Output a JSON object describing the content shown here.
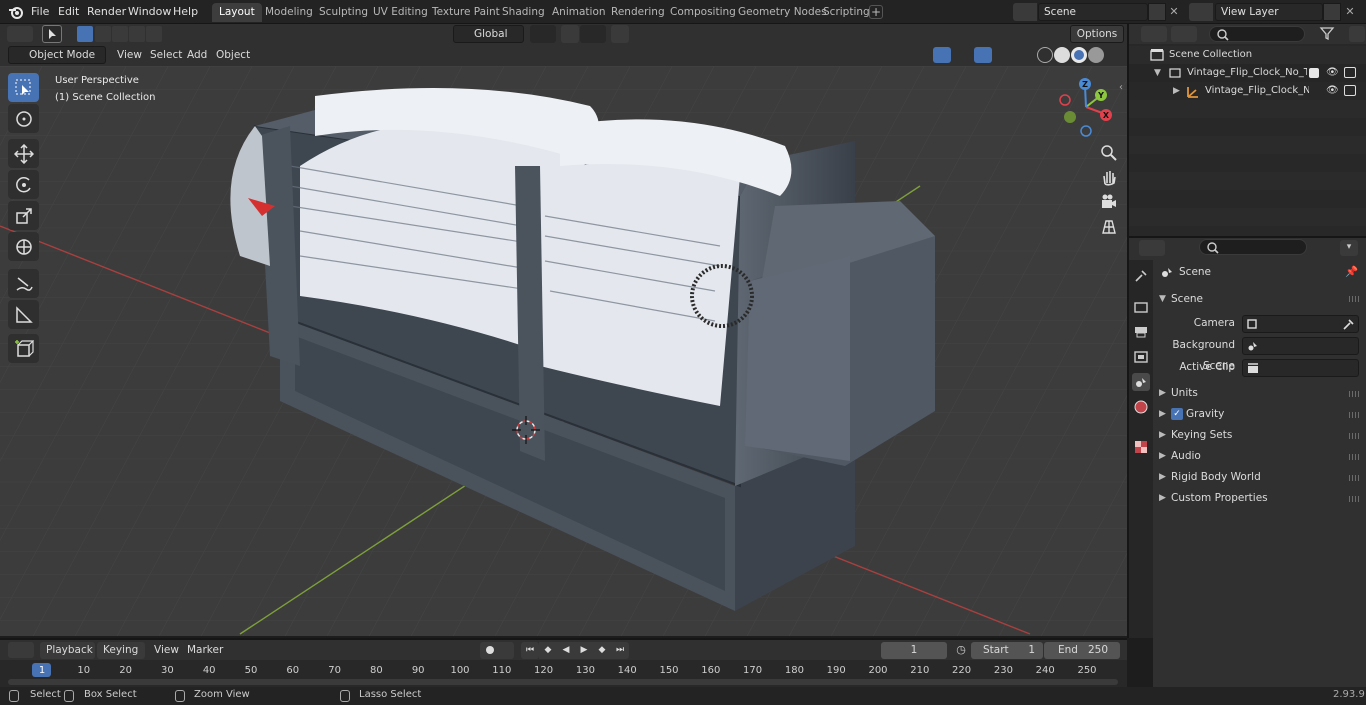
{
  "menu": {
    "file": "File",
    "edit": "Edit",
    "render": "Render",
    "window": "Window",
    "help": "Help"
  },
  "workspaces": [
    "Layout",
    "Modeling",
    "Sculpting",
    "UV Editing",
    "Texture Paint",
    "Shading",
    "Animation",
    "Rendering",
    "Compositing",
    "Geometry Nodes",
    "Scripting"
  ],
  "active_workspace": "Layout",
  "scene_field": "Scene",
  "view_layer_field": "View Layer",
  "viewport_header": {
    "mode": "Object Mode",
    "view": "View",
    "select": "Select",
    "add": "Add",
    "object": "Object",
    "transform_orientation": "Global",
    "options": "Options"
  },
  "viewport": {
    "perspective": "User Perspective",
    "collection": "(1) Scene Collection"
  },
  "gizmo": {
    "x": "X",
    "y": "Y",
    "z": "Z"
  },
  "outliner": {
    "scene_collection": "Scene Collection",
    "items": [
      {
        "label": "Vintage_Flip_Clock_No_Time_"
      },
      {
        "label": "Vintage_Flip_Clock_No_T"
      }
    ]
  },
  "properties": {
    "header": "Scene",
    "panel": "Scene",
    "camera_label": "Camera",
    "background_scene_label": "Background Scene",
    "active_clip_label": "Active Clip",
    "subpanels": [
      "Units",
      "Gravity",
      "Keying Sets",
      "Audio",
      "Rigid Body World",
      "Custom Properties"
    ],
    "gravity_checked": true
  },
  "timeline": {
    "playback": "Playback",
    "keying": "Keying",
    "view": "View",
    "marker": "Marker",
    "current_frame": "1",
    "start_label": "Start",
    "start": "1",
    "end_label": "End",
    "end": "250",
    "ticks": [
      "1",
      "10",
      "20",
      "30",
      "40",
      "50",
      "60",
      "70",
      "80",
      "90",
      "100",
      "110",
      "120",
      "130",
      "140",
      "150",
      "160",
      "170",
      "180",
      "190",
      "200",
      "210",
      "220",
      "230",
      "240",
      "250"
    ]
  },
  "statusbar": {
    "select": "Select",
    "box_select": "Box Select",
    "zoom_view": "Zoom View",
    "lasso_select": "Lasso Select",
    "version": "2.93.9"
  },
  "colors": {
    "accent": "#4772b3",
    "x_axis": "#e0414d",
    "y_axis": "#8cc63e",
    "z_axis": "#4a8bd6"
  }
}
